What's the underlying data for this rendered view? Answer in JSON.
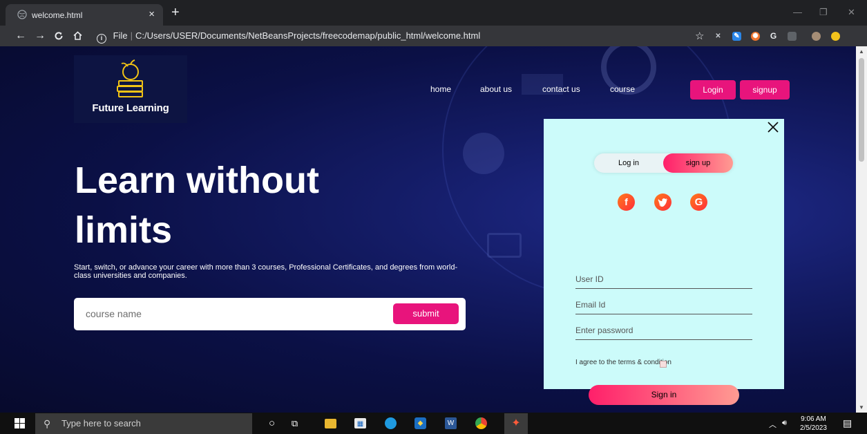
{
  "browser": {
    "tab_title": "welcome.html",
    "tab_close": "×",
    "new_tab": "+",
    "url_prefix": "File",
    "url": "C:/Users/USER/Documents/NetBeansProjects/freecodemap/public_html/welcome.html",
    "window_controls": [
      "—",
      "❐",
      "✕"
    ]
  },
  "site": {
    "brand": "Future Learning",
    "nav": [
      "home",
      "about us",
      "contact us",
      "course"
    ],
    "login_label": "Login",
    "signup_label": "signup"
  },
  "hero": {
    "title_line1": "Learn without",
    "title_line2": "limits",
    "subtitle": "Start, switch, or advance your career with more than 3 courses, Professional Certificates, and degrees from world-class universities and companies.",
    "search_placeholder": "course name",
    "submit_label": "submit"
  },
  "modal": {
    "tab_login": "Log in",
    "tab_signup": "sign up",
    "active_tab": "sign up",
    "social": [
      {
        "name": "facebook",
        "glyph": "f"
      },
      {
        "name": "twitter",
        "glyph": "t"
      },
      {
        "name": "google",
        "glyph": "G"
      }
    ],
    "user_id_placeholder": "User ID",
    "email_placeholder": "Email Id",
    "password_placeholder": "Enter password",
    "agree_text": "I agree to the terms & condition",
    "signin_label": "Sign in"
  },
  "taskbar": {
    "search_placeholder": "Type here to search",
    "time": "9:06 AM",
    "date": "2/5/2023"
  },
  "colors": {
    "accent_pink": "#e8147c",
    "modal_bg": "#ccfbfa",
    "hero_bg": "#0b1046"
  }
}
